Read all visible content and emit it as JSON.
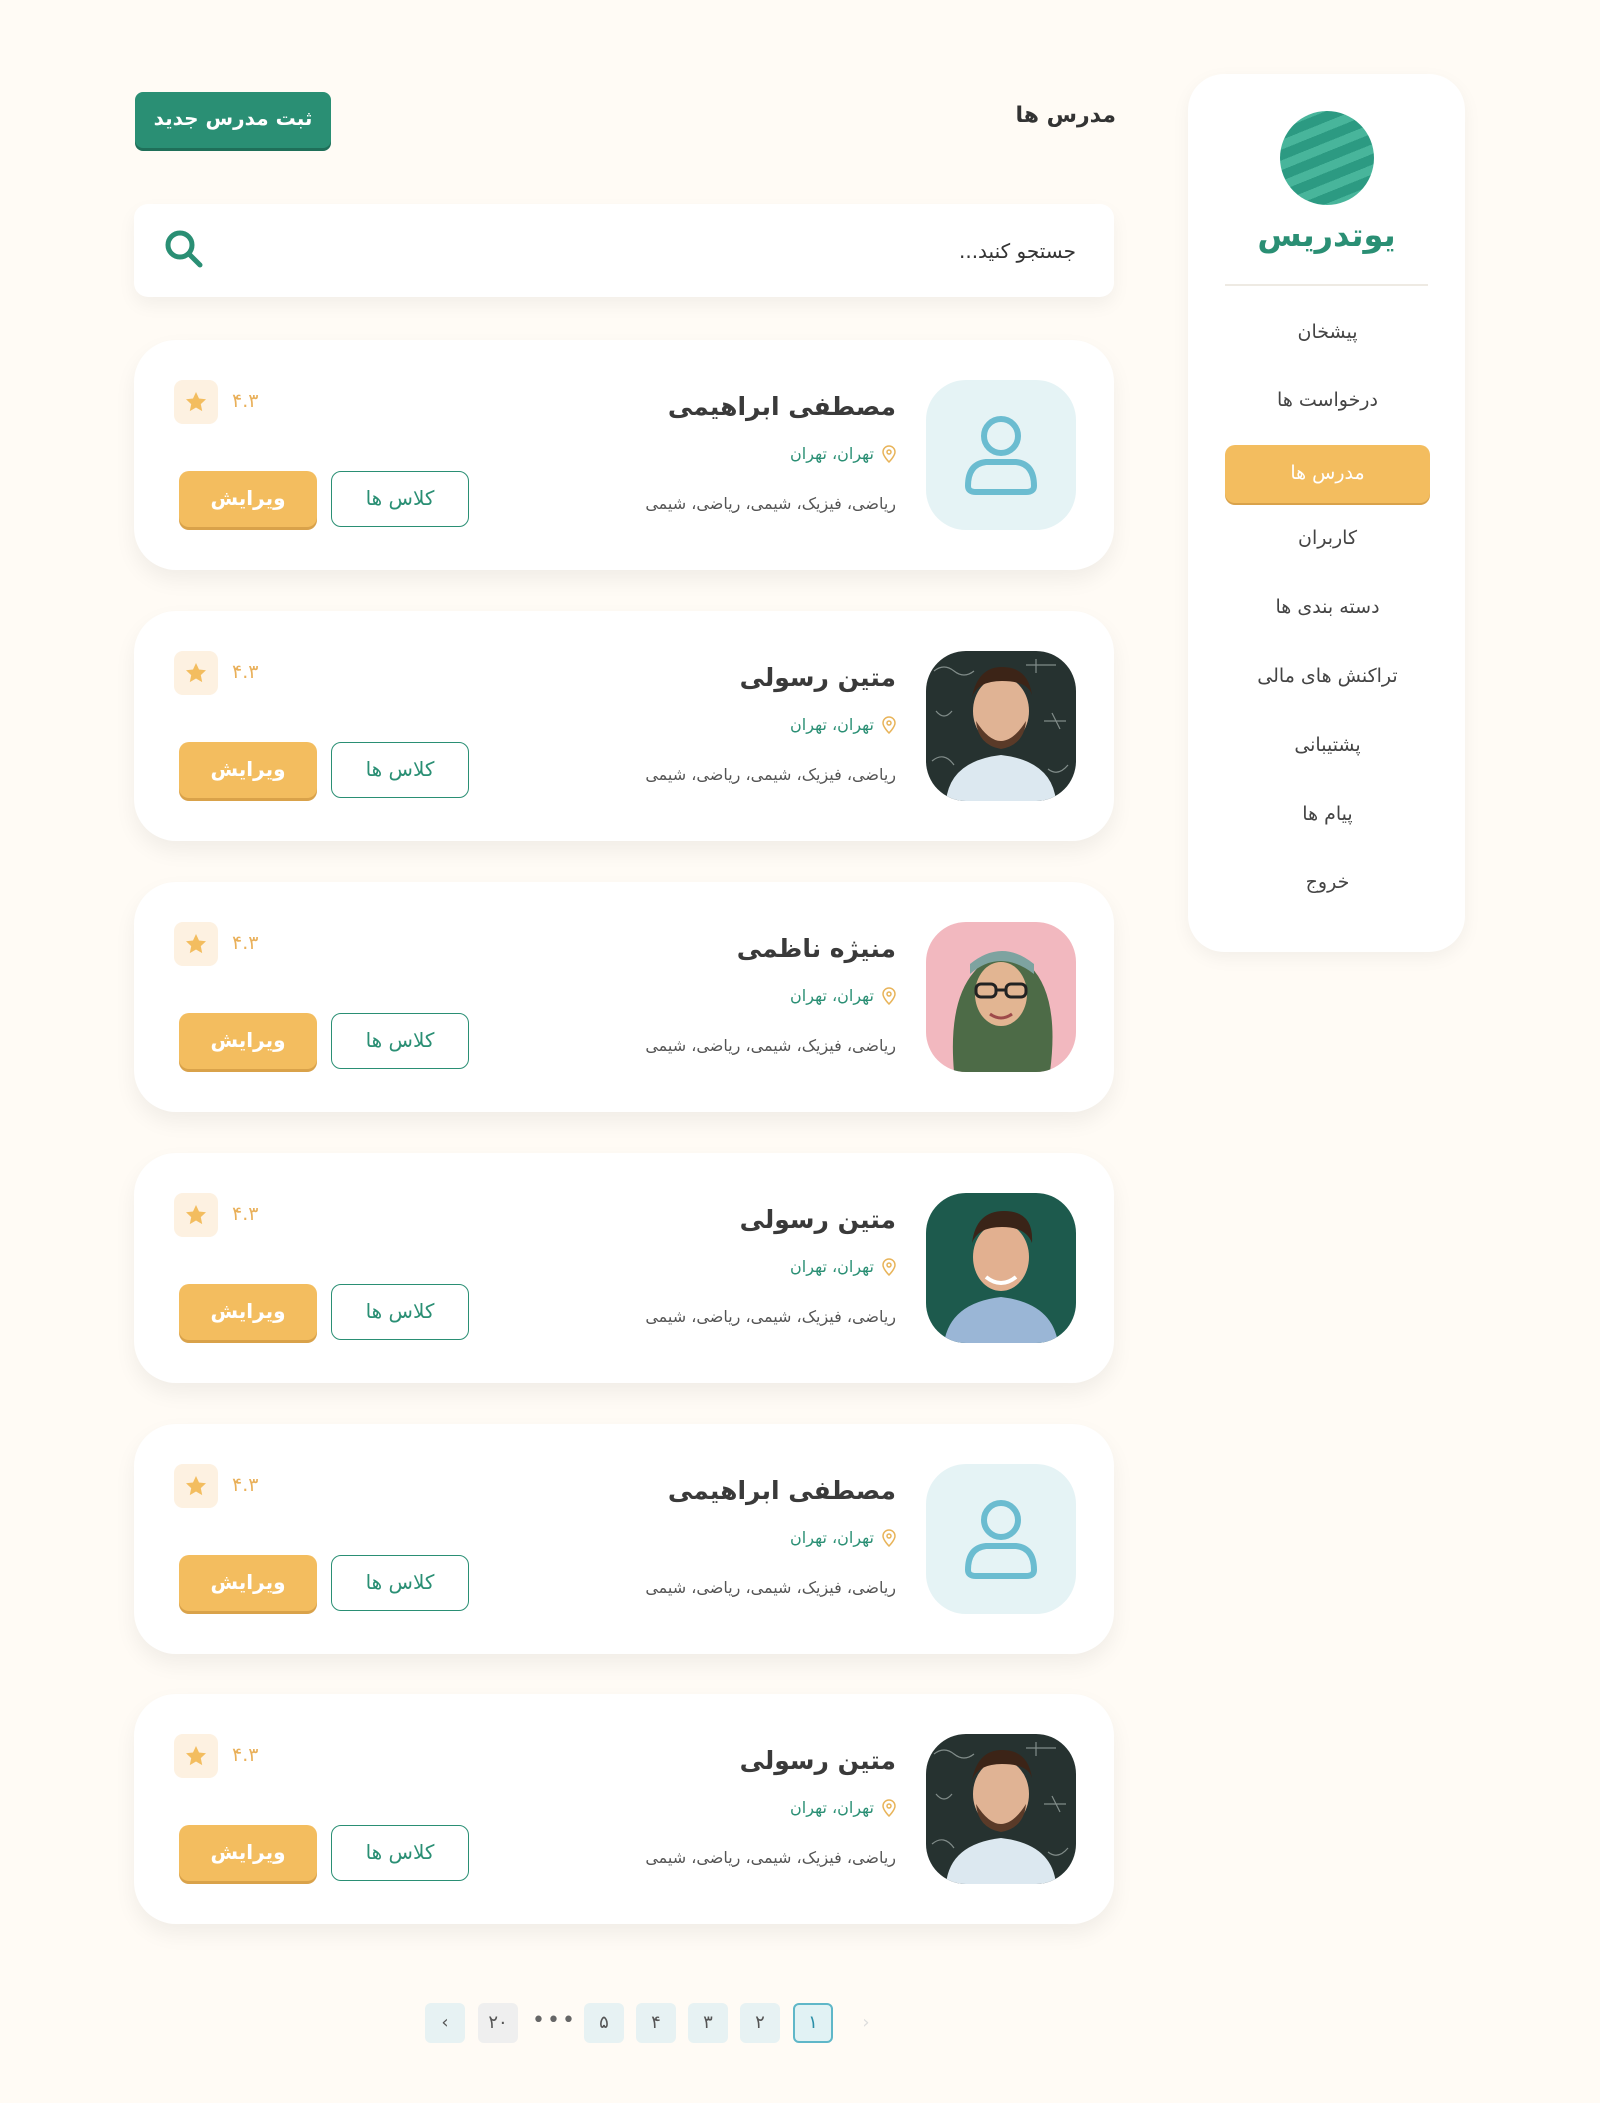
{
  "sidebar": {
    "brand": "یوتدریس",
    "items": [
      {
        "label": "پیشخان"
      },
      {
        "label": "درخواست ها"
      },
      {
        "label": "مدرس ها"
      },
      {
        "label": "کاربران"
      },
      {
        "label": "دسته بندی ها"
      },
      {
        "label": "تراکنش های مالی"
      },
      {
        "label": "پشتیبانی"
      },
      {
        "label": "پیام ها"
      },
      {
        "label": "خروج"
      }
    ],
    "active_index": 2
  },
  "header": {
    "title": "مدرس ها",
    "add_button": "ثبت مدرس جدید"
  },
  "search": {
    "placeholder": "جستجو کنید...",
    "value": ""
  },
  "teachers": [
    {
      "name": "مصطفی ابراهیمی",
      "location": "تهران، تهران",
      "subjects": "ریاضی، فیزیک، شیمی، ریاضی، شیمی",
      "rating": "۴.۳",
      "classes_label": "کلاس ها",
      "edit_label": "ویرایش",
      "avatar": "placeholder-user"
    },
    {
      "name": "متین رسولی",
      "location": "تهران، تهران",
      "subjects": "ریاضی، فیزیک، شیمی، ریاضی، شیمی",
      "rating": "۴.۳",
      "classes_label": "کلاس ها",
      "edit_label": "ویرایش",
      "avatar": "photo-man-chalkboard"
    },
    {
      "name": "منیژه ناظمی",
      "location": "تهران، تهران",
      "subjects": "ریاضی، فیزیک، شیمی، ریاضی، شیمی",
      "rating": "۴.۳",
      "classes_label": "کلاس ها",
      "edit_label": "ویرایش",
      "avatar": "photo-woman-hijab"
    },
    {
      "name": "متین رسولی",
      "location": "تهران، تهران",
      "subjects": "ریاضی، فیزیک، شیمی، ریاضی، شیمی",
      "rating": "۴.۳",
      "classes_label": "کلاس ها",
      "edit_label": "ویرایش",
      "avatar": "photo-man-green"
    },
    {
      "name": "مصطفی ابراهیمی",
      "location": "تهران، تهران",
      "subjects": "ریاضی، فیزیک، شیمی، ریاضی، شیمی",
      "rating": "۴.۳",
      "classes_label": "کلاس ها",
      "edit_label": "ویرایش",
      "avatar": "placeholder-user"
    },
    {
      "name": "متین رسولی",
      "location": "تهران، تهران",
      "subjects": "ریاضی، فیزیک، شیمی، ریاضی، شیمی",
      "rating": "۴.۳",
      "classes_label": "کلاس ها",
      "edit_label": "ویرایش",
      "avatar": "photo-man-chalkboard"
    }
  ],
  "pagination": {
    "pages": [
      "۱",
      "۲",
      "۳",
      "۴",
      "۵"
    ],
    "ellipsis": "•••",
    "last": "۲۰",
    "current": "۱"
  },
  "colors": {
    "primary": "#2a8f74",
    "accent": "#f3bd5f",
    "background": "#fffbf5"
  }
}
